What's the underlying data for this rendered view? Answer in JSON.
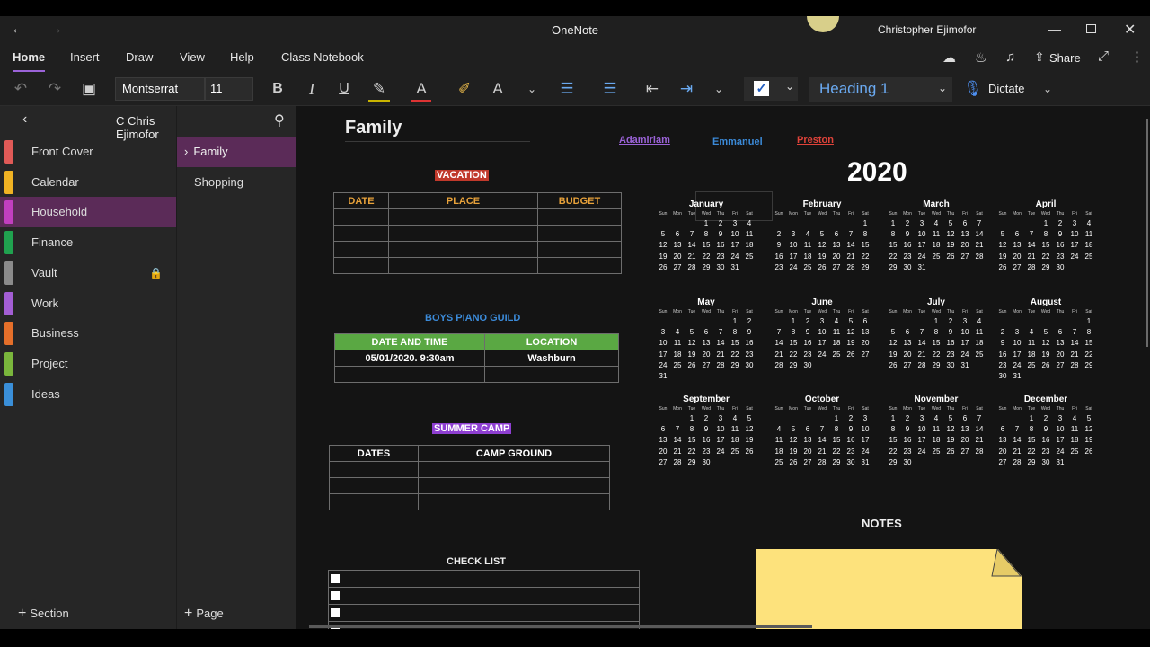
{
  "window": {
    "title": "OneNote",
    "user": "Christopher Ejimofor",
    "share_label": "Share"
  },
  "menu": {
    "items": [
      "Home",
      "Insert",
      "Draw",
      "View",
      "Help",
      "Class Notebook"
    ],
    "active": "Home"
  },
  "toolbar": {
    "font_name": "Montserrat",
    "font_size": "11",
    "style": "Heading 1",
    "dictate": "Dictate",
    "bold": "B",
    "italic": "I",
    "underline": "U"
  },
  "notebook": {
    "name": "C Chris Ejimofor"
  },
  "sections": [
    {
      "label": "Front Cover",
      "color": "#e05a57"
    },
    {
      "label": "Calendar",
      "color": "#f0b323"
    },
    {
      "label": "Household",
      "color": "#c13fbf",
      "active": true
    },
    {
      "label": "Finance",
      "color": "#20a24f"
    },
    {
      "label": "Vault",
      "color": "#8b8b8b",
      "locked": true
    },
    {
      "label": "Work",
      "color": "#a35ed4"
    },
    {
      "label": "Business",
      "color": "#e56f2a"
    },
    {
      "label": "Project",
      "color": "#7ab63c"
    },
    {
      "label": "Ideas",
      "color": "#3a8fd9"
    }
  ],
  "pages": [
    {
      "label": "Family",
      "active": true
    },
    {
      "label": "Shopping"
    }
  ],
  "footer": {
    "add_section": "Section",
    "add_page": "Page"
  },
  "page": {
    "title": "Family",
    "names": [
      {
        "label": "Adamiriam",
        "color": "#9b63d8"
      },
      {
        "label": "Emmanuel",
        "color": "#3b8ad8"
      },
      {
        "label": "Preston",
        "color": "#e0433a"
      }
    ],
    "vacation": {
      "title": "VACATION",
      "headers": [
        "DATE",
        "PLACE",
        "BUDGET"
      ]
    },
    "piano": {
      "title": "BOYS PIANO GUILD",
      "headers": [
        "DATE AND TIME",
        "LOCATION"
      ],
      "rows": [
        [
          "05/01/2020. 9:30am",
          "Washburn"
        ],
        [
          "",
          ""
        ]
      ]
    },
    "camp": {
      "title": "SUMMER CAMP",
      "headers": [
        "DATES",
        "CAMP GROUND"
      ]
    },
    "checklist": {
      "title": "CHECK LIST"
    },
    "notes": {
      "title": "NOTES"
    },
    "calendar": {
      "year": "2020",
      "dow": [
        "Sun",
        "Mon",
        "Tue",
        "Wed",
        "Thu",
        "Fri",
        "Sat"
      ],
      "months": [
        {
          "name": "January",
          "start": 3,
          "days": 31
        },
        {
          "name": "February",
          "start": 6,
          "days": 29
        },
        {
          "name": "March",
          "start": 0,
          "days": 31
        },
        {
          "name": "April",
          "start": 3,
          "days": 30
        },
        {
          "name": "May",
          "start": 5,
          "days": 31
        },
        {
          "name": "June",
          "start": 1,
          "days": 30
        },
        {
          "name": "July",
          "start": 3,
          "days": 31
        },
        {
          "name": "August",
          "start": 6,
          "days": 31
        },
        {
          "name": "September",
          "start": 2,
          "days": 30
        },
        {
          "name": "October",
          "start": 4,
          "days": 31
        },
        {
          "name": "November",
          "start": 0,
          "days": 30
        },
        {
          "name": "December",
          "start": 2,
          "days": 31
        }
      ]
    }
  }
}
